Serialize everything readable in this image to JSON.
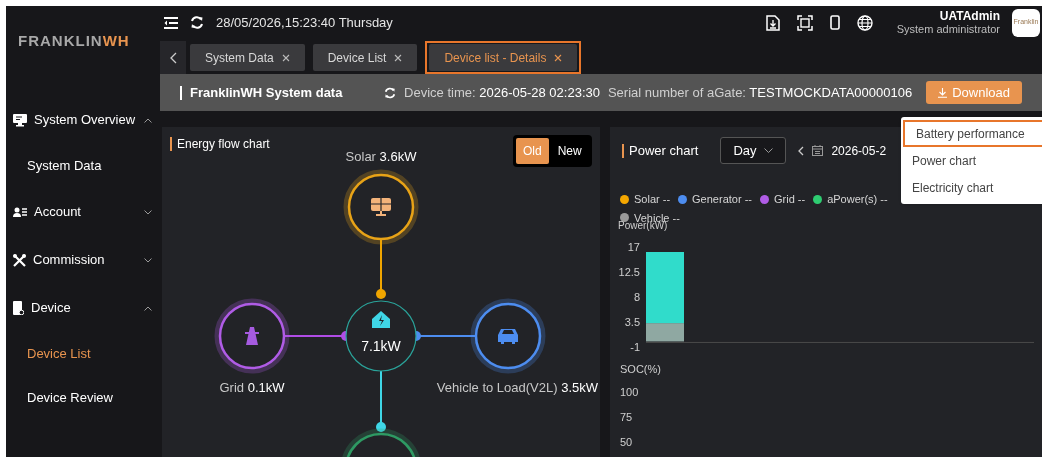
{
  "logo": {
    "main": "FRANKLIN",
    "accent": "WH"
  },
  "top_bar": {
    "datetime": "28/05/2026,15:23:40 Thursday",
    "user": {
      "name": "UATAdmin",
      "role": "System administrator",
      "avatar_text": "Franklin"
    }
  },
  "sidebar": {
    "items": [
      {
        "label": "System Overview",
        "expanded": true,
        "children": [
          {
            "label": "System Data",
            "selected": false
          }
        ]
      },
      {
        "label": "Account",
        "expanded": false
      },
      {
        "label": "Commission",
        "expanded": false
      },
      {
        "label": "Device",
        "expanded": true,
        "children": [
          {
            "label": "Device List",
            "selected": true
          },
          {
            "label": "Device Review",
            "selected": false
          }
        ]
      }
    ]
  },
  "tabs": [
    {
      "label": "System Data",
      "selected": false,
      "highlighted": false
    },
    {
      "label": "Device List",
      "selected": false,
      "highlighted": false
    },
    {
      "label": "Device list - Details",
      "selected": true,
      "highlighted": true
    }
  ],
  "header": {
    "title": "FranklinWH System data",
    "device_time_label": "Device time:",
    "device_time": "2026-05-28 02:23:30",
    "serial_label": "Serial number of aGate:",
    "serial": "TESTMOCKDATA00000106",
    "download": "Download"
  },
  "download_menu": [
    {
      "label": "Battery performance",
      "highlighted": true
    },
    {
      "label": "Power chart",
      "highlighted": false
    },
    {
      "label": "Electricity chart",
      "highlighted": false
    }
  ],
  "energy_flow": {
    "title": "Energy flow chart",
    "toggle": [
      {
        "label": "Old",
        "selected": true
      },
      {
        "label": "New",
        "selected": false
      }
    ],
    "center": "7.1kW",
    "nodes": [
      {
        "kind": "solar",
        "label": "Solar",
        "value": "3.6kW",
        "color": "#e8a317"
      },
      {
        "kind": "grid",
        "label": "Grid",
        "value": "0.1kW",
        "color": "#b05ce6"
      },
      {
        "kind": "vehicle",
        "label": "Vehicle to Load(V2L)",
        "value": "3.5kW",
        "color": "#4d8df0"
      },
      {
        "kind": "battery",
        "color": "#2e9a63"
      }
    ]
  },
  "power_chart": {
    "title": "Power chart",
    "period": "Day",
    "date": "2026-05-2",
    "legend": [
      {
        "name": "Solar",
        "value": "--",
        "color": "#f5a700"
      },
      {
        "name": "Generator",
        "value": "--",
        "color": "#4d8df0"
      },
      {
        "name": "Grid",
        "value": "--",
        "color": "#b05ce6"
      },
      {
        "name": "aPower(s)",
        "value": "--",
        "color": "#2ecc71"
      },
      {
        "name": "Vehicle",
        "value": "--",
        "color": "#9a9a9a"
      }
    ],
    "chart_data": {
      "type": "bar",
      "stacked": true,
      "ylabel": "Power(kW)",
      "ylim": [
        -1,
        17
      ],
      "yticks": [
        17,
        12.5,
        8,
        3.5,
        -1
      ],
      "series": [
        {
          "color": "#8fa8a2",
          "values": [
            3.3
          ]
        },
        {
          "color": "#30dccb",
          "values": [
            12.8
          ]
        }
      ]
    },
    "soc_axis": {
      "label": "SOC(%)",
      "ticks": [
        "100",
        "75",
        "50"
      ]
    }
  }
}
